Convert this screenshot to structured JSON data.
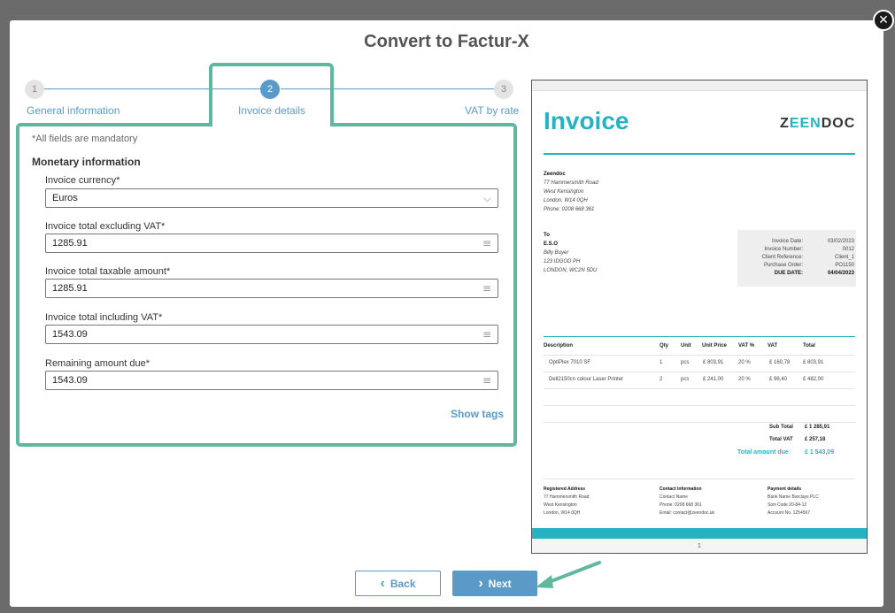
{
  "dialog": {
    "title": "Convert to Factur-X",
    "close_glyph": "✕"
  },
  "stepper": {
    "steps": [
      {
        "number": "1",
        "label": "General information",
        "state": "inactive"
      },
      {
        "number": "2",
        "label": "Invoice details",
        "state": "active"
      },
      {
        "number": "3",
        "label": "VAT by rate",
        "state": "inactive"
      }
    ]
  },
  "form": {
    "mandatory_note": "*All fields are mandatory",
    "section_title": "Monetary information",
    "fields": [
      {
        "label": "Invoice currency*",
        "value": "Euros",
        "icon": "chevron-down-icon",
        "glyph": "⌵"
      },
      {
        "label": "Invoice total excluding VAT*",
        "value": "1285.91",
        "icon": "menu-lines-icon",
        "glyph": "≡"
      },
      {
        "label": "Invoice total taxable amount*",
        "value": "1285.91",
        "icon": "menu-lines-icon",
        "glyph": "≡"
      },
      {
        "label": "Invoice total including VAT*",
        "value": "1543.09",
        "icon": "menu-lines-icon",
        "glyph": "≡"
      },
      {
        "label": "Remaining amount due*",
        "value": "1543.09",
        "icon": "menu-lines-icon",
        "glyph": "≡"
      }
    ],
    "show_tags": "Show tags"
  },
  "preview": {
    "title": "Invoice",
    "logo_left": "Z",
    "logo_mid": "EEN",
    "logo_right": "DOC",
    "seller": {
      "name": "Zeendoc",
      "line1": "77 Hammersmith Road",
      "line2": "West Kensington",
      "line3": "London, W14 0QH",
      "line4": "Phone: 0208 668 361"
    },
    "buyer": {
      "heading": "To",
      "name": "E.S.O",
      "line1": "Billy Buyer",
      "line2": "123 IDGOD PH",
      "line3": "LONDON, WC2N 5DU"
    },
    "meta": [
      {
        "label": "Invoice Date:",
        "value": "03/02/2023"
      },
      {
        "label": "Invoice Number:",
        "value": "0012"
      },
      {
        "label": "Client Reference:",
        "value": "Client_1"
      },
      {
        "label": "Purchase Order:",
        "value": "PO1150"
      },
      {
        "label": "DUE DATE:",
        "value": "04/04/2023"
      }
    ],
    "table_headers": [
      "Description",
      "Qty",
      "Unit",
      "Unit Price",
      "VAT %",
      "VAT",
      "Total"
    ],
    "rows": [
      [
        "OptiPlex 7010 SF",
        "1",
        "pcs",
        "£ 803,91",
        "20 %",
        "£ 160,78",
        "£ 803,91"
      ],
      [
        "Dell2150cn colour Laser Printer",
        "2",
        "pcs",
        "£ 241,00",
        "20 %",
        "£ 96,40",
        "£ 482,00"
      ]
    ],
    "totals": {
      "sub_total_label": "Sub Total",
      "sub_total": "£ 1 285,91",
      "total_vat_label": "Total VAT",
      "total_vat": "£ 257,18",
      "total_due_label": "Total amount due",
      "total_due": "£ 1 543,09"
    },
    "footer_cols": [
      {
        "heading": "Registered Address",
        "lines": [
          "77 Hammersmith Road",
          "West Kensington",
          "London, W14 0QH"
        ]
      },
      {
        "heading": "Contact Information",
        "lines": [
          "Contact Name",
          "Phone: 0208 668 361",
          "Email: contact@zeendoc.uk"
        ]
      },
      {
        "heading": "Payment details",
        "lines": [
          "Bank Name     Barclays PLC",
          "Sort-Code       20-84-12",
          "Account No.    1254567"
        ]
      }
    ],
    "page_number": "1"
  },
  "buttons": {
    "back": "Back",
    "back_glyph": "‹",
    "next": "Next",
    "next_glyph": "›"
  },
  "colors": {
    "accent": "#5b9ac6",
    "highlight": "#5fb89d",
    "invoice_teal": "#25b3c4"
  }
}
